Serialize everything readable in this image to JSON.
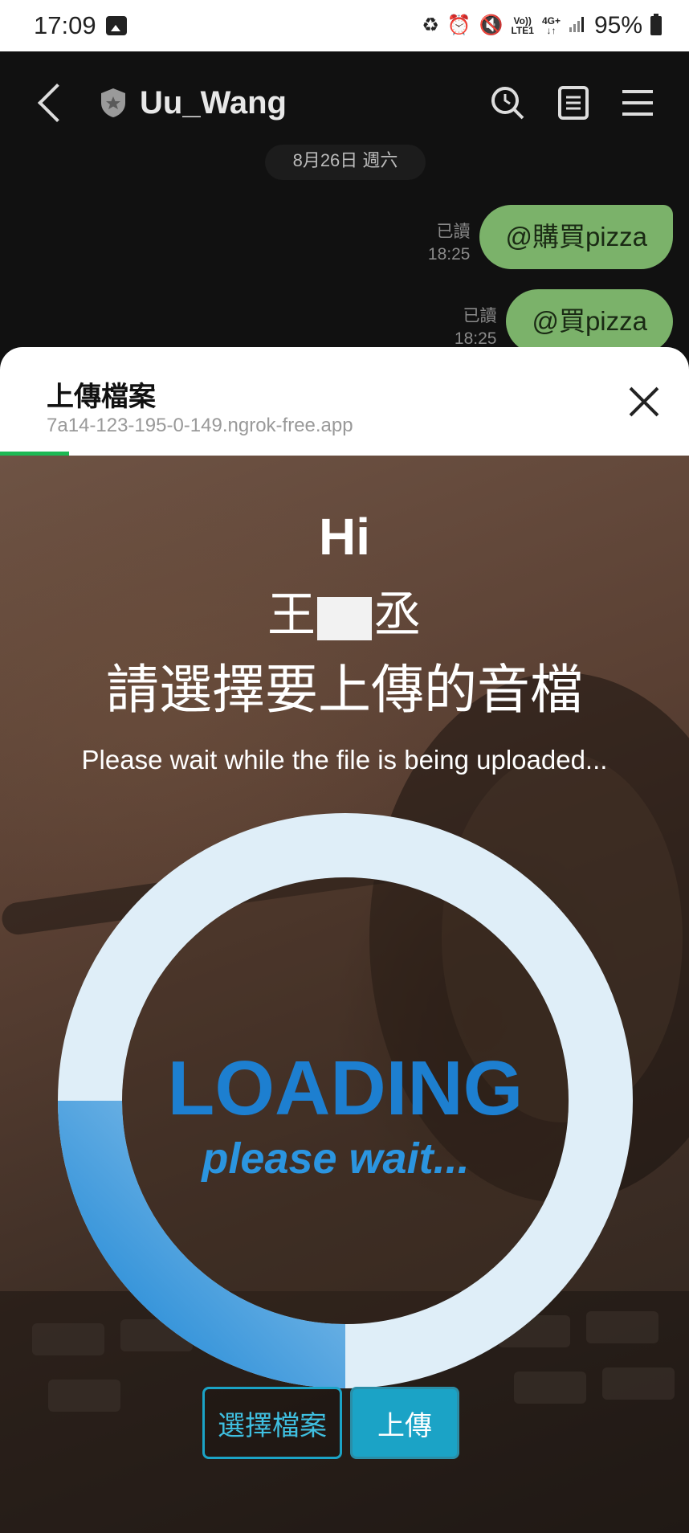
{
  "status_bar": {
    "time": "17:09",
    "volte": "Vo))",
    "lte": "LTE1",
    "network": "4G+",
    "battery": "95%"
  },
  "chat": {
    "title": "Uu_Wang",
    "date": "8月26日 週六",
    "messages": [
      {
        "read": "已讀",
        "time": "18:25",
        "text": "@購買pizza"
      },
      {
        "read": "已讀",
        "time": "18:25",
        "text": "@買pizza"
      }
    ]
  },
  "sheet": {
    "title": "上傳檔案",
    "url": "7a14-123-195-0-149.ngrok-free.app",
    "load_progress": 0.1
  },
  "page": {
    "hi": "Hi",
    "name_first": "王",
    "name_last": "丞",
    "prompt": "請選擇要上傳的音檔",
    "wait": "Please wait while the file is being uploaded...",
    "loading": "LOADING",
    "please_wait": "please wait...",
    "progress": 0.25,
    "choose_file": "選擇檔案",
    "upload": "上傳"
  },
  "colors": {
    "bubble": "#7bb26a",
    "accent": "#1ba3c6",
    "ring_fill": "#2b8fdc",
    "ring_track": "#e0eef8"
  }
}
